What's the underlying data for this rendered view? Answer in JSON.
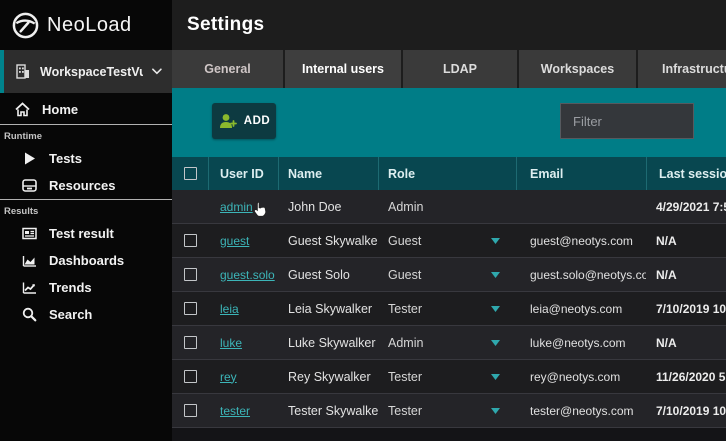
{
  "sidebar": {
    "brand": "NeoLoad",
    "workspace_label": "WorkspaceTestVuC",
    "home_label": "Home",
    "runtime_section_label": "Runtime",
    "tests_label": "Tests",
    "resources_label": "Resources",
    "results_section_label": "Results",
    "test_result_label": "Test result",
    "dashboards_label": "Dashboards",
    "trends_label": "Trends",
    "search_label": "Search"
  },
  "header": {
    "title": "Settings"
  },
  "tabs": {
    "items": [
      {
        "label": "General",
        "active": false
      },
      {
        "label": "Internal users",
        "active": true
      },
      {
        "label": "LDAP",
        "active": false
      },
      {
        "label": "Workspaces",
        "active": false
      },
      {
        "label": "Infrastructure",
        "active": false
      }
    ]
  },
  "toolbar": {
    "add_label": "ADD",
    "filter_placeholder": "Filter",
    "filter_value": ""
  },
  "table": {
    "columns": [
      "User ID",
      "Name",
      "Role",
      "Email",
      "Last session"
    ],
    "rows": [
      {
        "user_id": "admin",
        "name": "John Doe",
        "role": "Admin",
        "email": "",
        "last_session": "4/29/2021 7:5",
        "has_checkbox": false,
        "has_role_dropdown": false
      },
      {
        "user_id": "guest",
        "name": "Guest Skywalker",
        "role": "Guest",
        "email": "guest@neotys.com",
        "last_session": "N/A",
        "has_checkbox": true,
        "has_role_dropdown": true
      },
      {
        "user_id": "guest.solo",
        "name": "Guest Solo",
        "role": "Guest",
        "email": "guest.solo@neotys.com",
        "last_session": "N/A",
        "has_checkbox": true,
        "has_role_dropdown": true
      },
      {
        "user_id": "leia",
        "name": "Leia Skywalker",
        "role": "Tester",
        "email": "leia@neotys.com",
        "last_session": "7/10/2019 10:",
        "has_checkbox": true,
        "has_role_dropdown": true
      },
      {
        "user_id": "luke",
        "name": "Luke Skywalker",
        "role": "Admin",
        "email": "luke@neotys.com",
        "last_session": "N/A",
        "has_checkbox": true,
        "has_role_dropdown": true
      },
      {
        "user_id": "rey",
        "name": "Rey Skywalker",
        "role": "Tester",
        "email": "rey@neotys.com",
        "last_session": "11/26/2020 5:",
        "has_checkbox": true,
        "has_role_dropdown": true
      },
      {
        "user_id": "tester",
        "name": "Tester Skywalker",
        "role": "Tester",
        "email": "tester@neotys.com",
        "last_session": "7/10/2019 10:",
        "has_checkbox": true,
        "has_role_dropdown": true
      }
    ]
  },
  "colors": {
    "accent_teal": "#007d87",
    "table_header_teal": "#084750",
    "workspace_accent": "#00838c",
    "link_teal": "#3cb5b8",
    "add_icon_green": "#8ab92d"
  }
}
